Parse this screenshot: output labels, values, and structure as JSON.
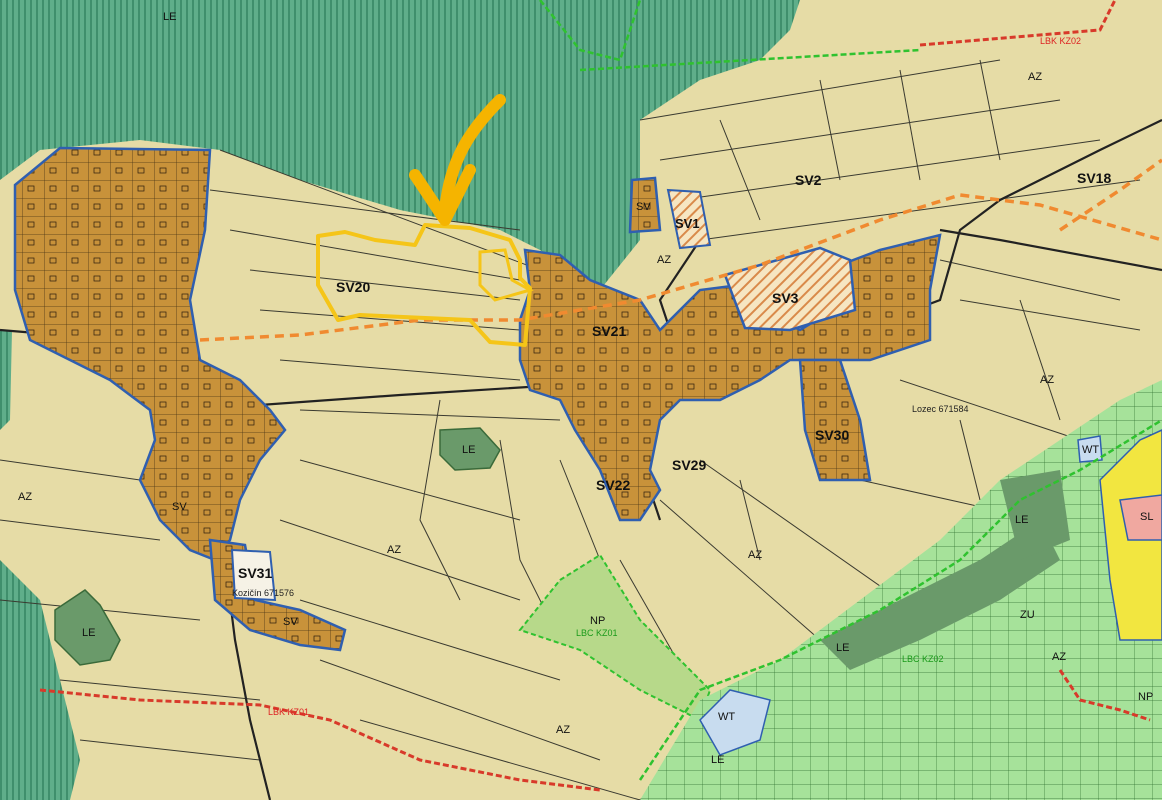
{
  "colors": {
    "agricultural": "#e6dca6",
    "forest": "#5fae8a",
    "village": "#c8923a",
    "village_border": "#2f5fb0",
    "parcel_line": "#3a3a30",
    "highlight": "#f5c518",
    "bio_corridor": "#2fc22f",
    "regional_corridor": "#d83a2a",
    "planned_corridor": "#f08a30",
    "water": "#c8dcef",
    "greenery": "#9ed98a",
    "meadow": "#6a9a6a",
    "mixed": "#f2e640"
  },
  "labels": {
    "le_top": "LE",
    "sv2": "SV2",
    "sv18": "SV18",
    "sv1": "SV1",
    "sv_small": "SV",
    "az_top": "AZ",
    "az_a": "AZ",
    "sv20": "SV20",
    "sv3": "SV3",
    "sv21": "SV21",
    "sv29": "SV29",
    "sv22": "SV22",
    "sv30": "SV30",
    "sv31": "SV31",
    "sv_bottom": "SV",
    "sv_left": "SV",
    "az_left": "AZ",
    "az_mid": "AZ",
    "az_center": "AZ",
    "az_right": "AZ",
    "az_bottom": "AZ",
    "az_bottom_right": "AZ",
    "le_center": "LE",
    "le_left": "LE",
    "le_right": "LE",
    "le_bottom": "LE",
    "le_bottom_mid": "LE",
    "np": "NP",
    "wt_right": "WT",
    "wt_bottom": "WT",
    "zu": "ZU",
    "lozec": "Lozec 671584",
    "kozicin": "Kozičín 671576",
    "lbc_kz01": "LBC KZ01",
    "lbc_kz02": "LBC KZ02",
    "lbk_kz01": "LBK KZ01",
    "lbk_top": "LBK KZ02",
    "sl": "SL",
    "np_right": "NP"
  }
}
